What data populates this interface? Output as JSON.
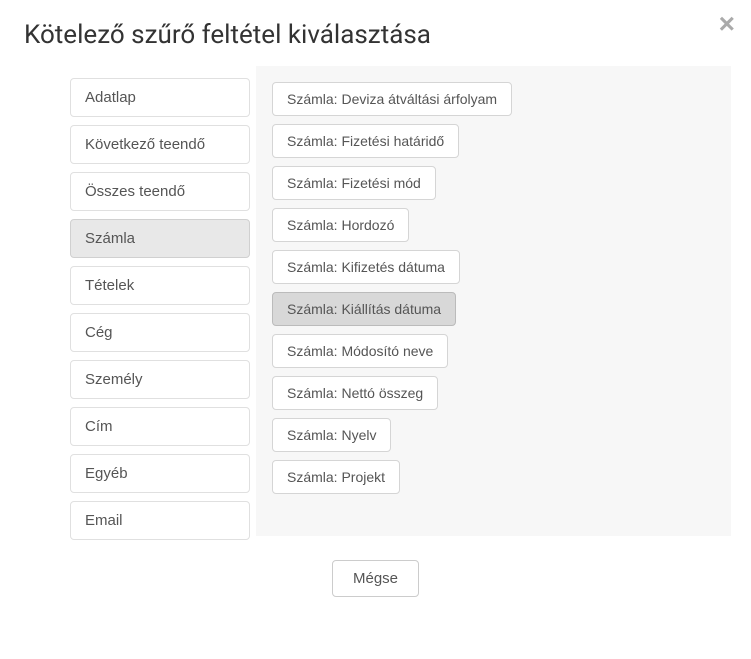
{
  "modal": {
    "title": "Kötelező szűrő feltétel kiválasztása",
    "close_label": "×"
  },
  "categories": [
    {
      "label": "Adatlap",
      "active": false
    },
    {
      "label": "Következő teendő",
      "active": false
    },
    {
      "label": "Összes teendő",
      "active": false
    },
    {
      "label": "Számla",
      "active": true
    },
    {
      "label": "Tételek",
      "active": false
    },
    {
      "label": "Cég",
      "active": false
    },
    {
      "label": "Személy",
      "active": false
    },
    {
      "label": "Cím",
      "active": false
    },
    {
      "label": "Egyéb",
      "active": false
    },
    {
      "label": "Email",
      "active": false
    }
  ],
  "filters": [
    {
      "label": "Számla: Deviza átváltási árfolyam",
      "selected": false
    },
    {
      "label": "Számla: Fizetési határidő",
      "selected": false
    },
    {
      "label": "Számla: Fizetési mód",
      "selected": false
    },
    {
      "label": "Számla: Hordozó",
      "selected": false
    },
    {
      "label": "Számla: Kifizetés dátuma",
      "selected": false
    },
    {
      "label": "Számla: Kiállítás dátuma",
      "selected": true
    },
    {
      "label": "Számla: Módosító neve",
      "selected": false
    },
    {
      "label": "Számla: Nettó összeg",
      "selected": false
    },
    {
      "label": "Számla: Nyelv",
      "selected": false
    },
    {
      "label": "Számla: Projekt",
      "selected": false
    }
  ],
  "footer": {
    "cancel_label": "Mégse"
  }
}
